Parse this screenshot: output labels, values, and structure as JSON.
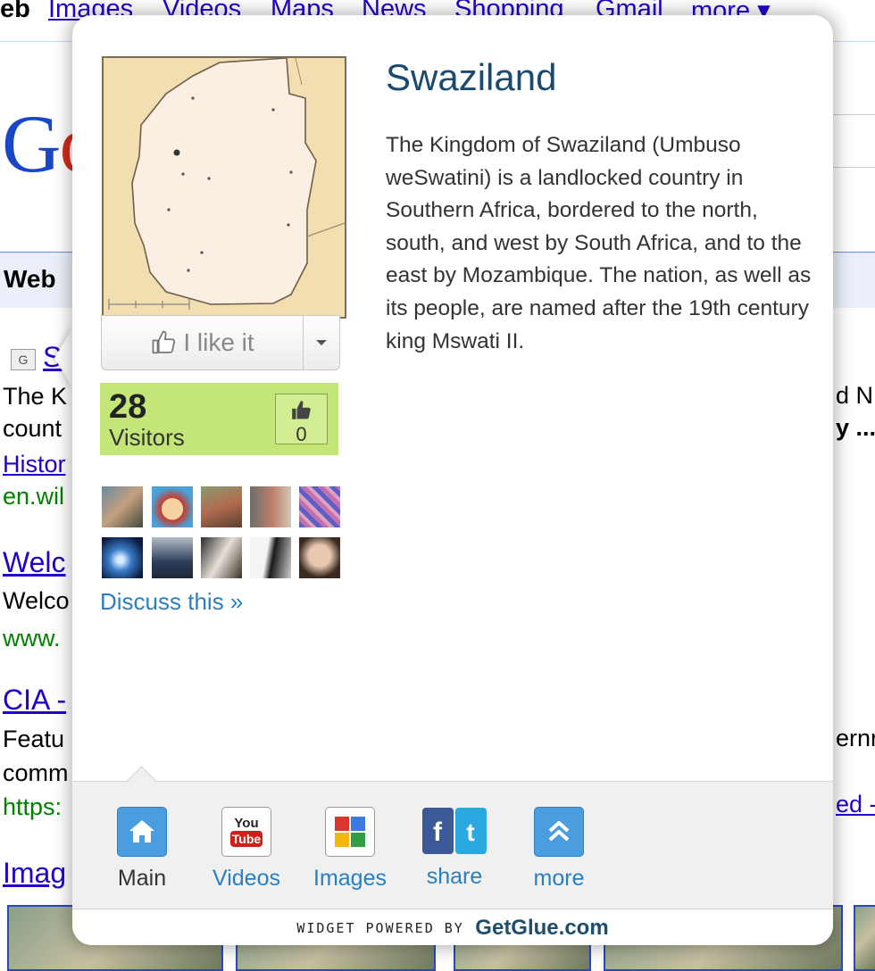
{
  "google": {
    "nav_current": "eb",
    "nav_links": [
      "Images",
      "Videos",
      "Maps",
      "News",
      "Shopping",
      "Gmail",
      "more ▾"
    ],
    "logo": "Go",
    "web_label": "Web",
    "results": [
      {
        "title": "S",
        "snippet": "The K",
        "snippet2": "count",
        "link": "Histor",
        "url": "en.wil"
      },
      {
        "title": "Welc",
        "snippet": "Welco",
        "url": "www."
      },
      {
        "title": "CIA -",
        "snippet": "Featu",
        "snippet2": "comm",
        "url": "https:"
      },
      {
        "title": "Imag"
      }
    ],
    "right_fragments": [
      "d N",
      "y ...",
      "ernn",
      "ed -"
    ]
  },
  "widget": {
    "title": "Swaziland",
    "description": "The Kingdom of Swaziland (Umbuso weSwatini) is a landlocked country in Southern Africa, bordered to the north, south, and west by South Africa, and to the east by Mozambique. The nation, as well as its people, are named after the 19th century king Mswati II.",
    "like_label": "I like it",
    "visitor_count": "28",
    "visitors_label": "Visitors",
    "thumbs_count": "0",
    "discuss_label": "Discuss this »",
    "tabs": [
      {
        "label": "Main",
        "icon": "home-icon",
        "active": true
      },
      {
        "label": "Videos",
        "icon": "youtube-icon",
        "active": false
      },
      {
        "label": "Images",
        "icon": "google-images-icon",
        "active": false
      },
      {
        "label": "share",
        "icon": "facebook-twitter-icon",
        "active": false
      },
      {
        "label": "more",
        "icon": "chevron-up-icon",
        "active": false
      }
    ],
    "footer_powered": "WIDGET POWERED BY",
    "footer_brand": "GetGlue.com"
  },
  "colors": {
    "visitors_bg": "#c4e678",
    "link_blue": "#2a7fc0",
    "title_blue": "#1a4a72",
    "map_land": "#fbeee3",
    "map_bg": "#f2deb0"
  }
}
